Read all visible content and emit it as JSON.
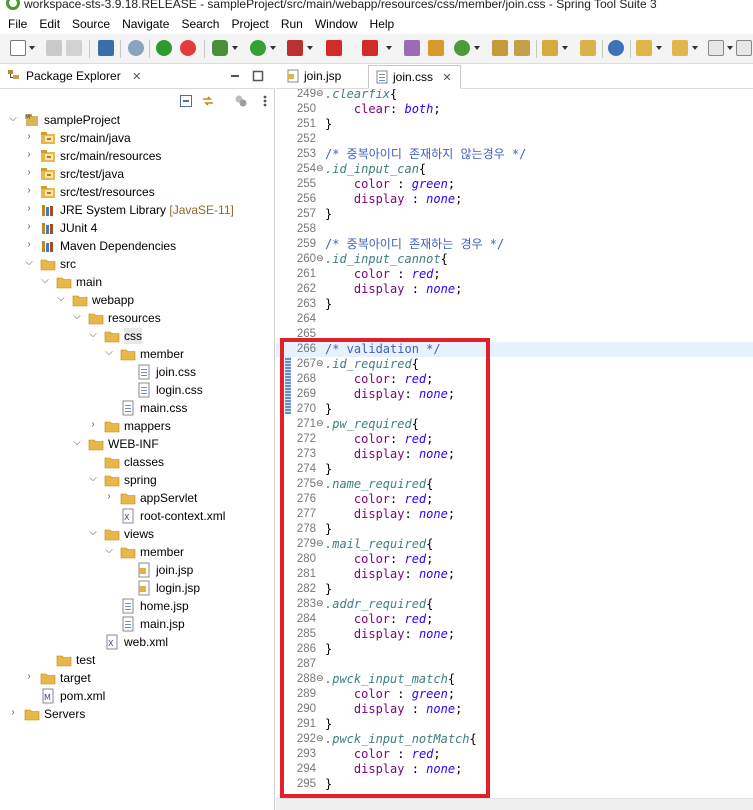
{
  "window": {
    "title": "workspace-sts-3.9.18.RELEASE - sampleProject/src/main/webapp/resources/css/member/join.css - Spring Tool Suite 3"
  },
  "menu": [
    "File",
    "Edit",
    "Source",
    "Navigate",
    "Search",
    "Project",
    "Run",
    "Window",
    "Help"
  ],
  "package_explorer": {
    "title": "Package Explorer",
    "close_glyph": "✕",
    "tree": [
      {
        "label": "sampleProject",
        "indent": 0,
        "twisty": "open",
        "icon": "project-icon"
      },
      {
        "label": "src/main/java",
        "indent": 1,
        "twisty": "closed",
        "icon": "source-folder-icon"
      },
      {
        "label": "src/main/resources",
        "indent": 1,
        "twisty": "closed",
        "icon": "source-folder-icon"
      },
      {
        "label": "src/test/java",
        "indent": 1,
        "twisty": "closed",
        "icon": "source-folder-icon"
      },
      {
        "label": "src/test/resources",
        "indent": 1,
        "twisty": "closed",
        "icon": "source-folder-icon"
      },
      {
        "label": "JRE System Library",
        "decoration": " [JavaSE-11]",
        "indent": 1,
        "twisty": "closed",
        "icon": "library-icon"
      },
      {
        "label": "JUnit 4",
        "indent": 1,
        "twisty": "closed",
        "icon": "library-icon"
      },
      {
        "label": "Maven Dependencies",
        "indent": 1,
        "twisty": "closed",
        "icon": "library-icon"
      },
      {
        "label": "src",
        "indent": 1,
        "twisty": "open",
        "icon": "folder-icon"
      },
      {
        "label": "main",
        "indent": 2,
        "twisty": "open",
        "icon": "folder-icon"
      },
      {
        "label": "webapp",
        "indent": 3,
        "twisty": "open",
        "icon": "folder-icon"
      },
      {
        "label": "resources",
        "indent": 4,
        "twisty": "open",
        "icon": "folder-icon"
      },
      {
        "label": "css",
        "indent": 5,
        "twisty": "open",
        "icon": "folder-icon",
        "selected": true
      },
      {
        "label": "member",
        "indent": 6,
        "twisty": "open",
        "icon": "folder-icon"
      },
      {
        "label": "join.css",
        "indent": 7,
        "twisty": "none",
        "icon": "file-icon"
      },
      {
        "label": "login.css",
        "indent": 7,
        "twisty": "none",
        "icon": "file-icon"
      },
      {
        "label": "main.css",
        "indent": 6,
        "twisty": "none",
        "icon": "file-icon"
      },
      {
        "label": "mappers",
        "indent": 5,
        "twisty": "closed",
        "icon": "folder-icon"
      },
      {
        "label": "WEB-INF",
        "indent": 4,
        "twisty": "open",
        "icon": "folder-icon"
      },
      {
        "label": "classes",
        "indent": 5,
        "twisty": "none",
        "icon": "folder-icon"
      },
      {
        "label": "spring",
        "indent": 5,
        "twisty": "open",
        "icon": "folder-icon"
      },
      {
        "label": "appServlet",
        "indent": 6,
        "twisty": "closed",
        "icon": "folder-icon"
      },
      {
        "label": "root-context.xml",
        "indent": 6,
        "twisty": "none",
        "icon": "xml-file-icon"
      },
      {
        "label": "views",
        "indent": 5,
        "twisty": "open",
        "icon": "folder-icon"
      },
      {
        "label": "member",
        "indent": 6,
        "twisty": "open",
        "icon": "folder-icon"
      },
      {
        "label": "join.jsp",
        "indent": 7,
        "twisty": "none",
        "icon": "jsp-file-icon"
      },
      {
        "label": "login.jsp",
        "indent": 7,
        "twisty": "none",
        "icon": "jsp-file-icon"
      },
      {
        "label": "home.jsp",
        "indent": 6,
        "twisty": "none",
        "icon": "file-icon"
      },
      {
        "label": "main.jsp",
        "indent": 6,
        "twisty": "none",
        "icon": "file-icon"
      },
      {
        "label": "web.xml",
        "indent": 5,
        "twisty": "none",
        "icon": "xml-file-icon"
      },
      {
        "label": "test",
        "indent": 2,
        "twisty": "none",
        "icon": "folder-icon"
      },
      {
        "label": "target",
        "indent": 1,
        "twisty": "closed",
        "icon": "folder-icon"
      },
      {
        "label": "pom.xml",
        "indent": 1,
        "twisty": "none",
        "icon": "maven-file-icon"
      },
      {
        "label": "Servers",
        "indent": 0,
        "twisty": "closed",
        "icon": "folder-icon"
      }
    ]
  },
  "editor": {
    "tabs": [
      {
        "label": "join.jsp",
        "active": false
      },
      {
        "label": "join.css",
        "active": true
      }
    ],
    "close_glyph": "✕",
    "lines": [
      {
        "n": "249",
        "fold": "⊖",
        "tokens": [
          {
            "t": "sel",
            "v": ".clearfix"
          },
          {
            "t": "pun",
            "v": "{"
          }
        ]
      },
      {
        "n": "250",
        "tokens": [
          {
            "t": "pun",
            "v": "    "
          },
          {
            "t": "prop",
            "v": "clear"
          },
          {
            "t": "pun",
            "v": ": "
          },
          {
            "t": "val",
            "v": "both"
          },
          {
            "t": "pun",
            "v": ";"
          }
        ]
      },
      {
        "n": "251",
        "tokens": [
          {
            "t": "pun",
            "v": "}"
          }
        ]
      },
      {
        "n": "252",
        "tokens": []
      },
      {
        "n": "253",
        "tokens": [
          {
            "t": "cmt",
            "v": "/* 중복아이디 존재하지 않는경우 */"
          }
        ]
      },
      {
        "n": "254",
        "fold": "⊖",
        "tokens": [
          {
            "t": "sel",
            "v": ".id_input_can"
          },
          {
            "t": "pun",
            "v": "{"
          }
        ]
      },
      {
        "n": "255",
        "tokens": [
          {
            "t": "pun",
            "v": "    "
          },
          {
            "t": "prop",
            "v": "color"
          },
          {
            "t": "pun",
            "v": " : "
          },
          {
            "t": "val",
            "v": "green"
          },
          {
            "t": "pun",
            "v": ";"
          }
        ]
      },
      {
        "n": "256",
        "tokens": [
          {
            "t": "pun",
            "v": "    "
          },
          {
            "t": "prop",
            "v": "display"
          },
          {
            "t": "pun",
            "v": " : "
          },
          {
            "t": "val",
            "v": "none"
          },
          {
            "t": "pun",
            "v": ";"
          }
        ]
      },
      {
        "n": "257",
        "tokens": [
          {
            "t": "pun",
            "v": "}"
          }
        ]
      },
      {
        "n": "258",
        "tokens": []
      },
      {
        "n": "259",
        "tokens": [
          {
            "t": "cmt",
            "v": "/* 중복아이디 존재하는 경우 */"
          }
        ]
      },
      {
        "n": "260",
        "fold": "⊖",
        "tokens": [
          {
            "t": "sel",
            "v": ".id_input_cannot"
          },
          {
            "t": "pun",
            "v": "{"
          }
        ]
      },
      {
        "n": "261",
        "tokens": [
          {
            "t": "pun",
            "v": "    "
          },
          {
            "t": "prop",
            "v": "color"
          },
          {
            "t": "pun",
            "v": " : "
          },
          {
            "t": "val",
            "v": "red"
          },
          {
            "t": "pun",
            "v": ";"
          }
        ]
      },
      {
        "n": "262",
        "tokens": [
          {
            "t": "pun",
            "v": "    "
          },
          {
            "t": "prop",
            "v": "display"
          },
          {
            "t": "pun",
            "v": " : "
          },
          {
            "t": "val",
            "v": "none"
          },
          {
            "t": "pun",
            "v": ";"
          }
        ]
      },
      {
        "n": "263",
        "tokens": [
          {
            "t": "pun",
            "v": "}"
          }
        ]
      },
      {
        "n": "264",
        "tokens": []
      },
      {
        "n": "265",
        "tokens": []
      },
      {
        "n": "266",
        "highlight": true,
        "tokens": [
          {
            "t": "cmt",
            "v": "/* validation */"
          }
        ]
      },
      {
        "n": "267",
        "fold": "⊖",
        "tokens": [
          {
            "t": "sel",
            "v": ".id_required"
          },
          {
            "t": "pun",
            "v": "{"
          }
        ]
      },
      {
        "n": "268",
        "tokens": [
          {
            "t": "pun",
            "v": "    "
          },
          {
            "t": "prop",
            "v": "color"
          },
          {
            "t": "pun",
            "v": ": "
          },
          {
            "t": "val",
            "v": "red"
          },
          {
            "t": "pun",
            "v": ";"
          }
        ]
      },
      {
        "n": "269",
        "tokens": [
          {
            "t": "pun",
            "v": "    "
          },
          {
            "t": "prop",
            "v": "display"
          },
          {
            "t": "pun",
            "v": ": "
          },
          {
            "t": "val",
            "v": "none"
          },
          {
            "t": "pun",
            "v": ";"
          }
        ]
      },
      {
        "n": "270",
        "tokens": [
          {
            "t": "pun",
            "v": "}"
          }
        ]
      },
      {
        "n": "271",
        "fold": "⊖",
        "tokens": [
          {
            "t": "sel",
            "v": ".pw_required"
          },
          {
            "t": "pun",
            "v": "{"
          }
        ]
      },
      {
        "n": "272",
        "tokens": [
          {
            "t": "pun",
            "v": "    "
          },
          {
            "t": "prop",
            "v": "color"
          },
          {
            "t": "pun",
            "v": ": "
          },
          {
            "t": "val",
            "v": "red"
          },
          {
            "t": "pun",
            "v": ";"
          }
        ]
      },
      {
        "n": "273",
        "tokens": [
          {
            "t": "pun",
            "v": "    "
          },
          {
            "t": "prop",
            "v": "display"
          },
          {
            "t": "pun",
            "v": ": "
          },
          {
            "t": "val",
            "v": "none"
          },
          {
            "t": "pun",
            "v": ";"
          }
        ]
      },
      {
        "n": "274",
        "tokens": [
          {
            "t": "pun",
            "v": "}"
          }
        ]
      },
      {
        "n": "275",
        "fold": "⊖",
        "tokens": [
          {
            "t": "sel",
            "v": ".name_required"
          },
          {
            "t": "pun",
            "v": "{"
          }
        ]
      },
      {
        "n": "276",
        "tokens": [
          {
            "t": "pun",
            "v": "    "
          },
          {
            "t": "prop",
            "v": "color"
          },
          {
            "t": "pun",
            "v": ": "
          },
          {
            "t": "val",
            "v": "red"
          },
          {
            "t": "pun",
            "v": ";"
          }
        ]
      },
      {
        "n": "277",
        "tokens": [
          {
            "t": "pun",
            "v": "    "
          },
          {
            "t": "prop",
            "v": "display"
          },
          {
            "t": "pun",
            "v": ": "
          },
          {
            "t": "val",
            "v": "none"
          },
          {
            "t": "pun",
            "v": ";"
          }
        ]
      },
      {
        "n": "278",
        "tokens": [
          {
            "t": "pun",
            "v": "}"
          }
        ]
      },
      {
        "n": "279",
        "fold": "⊖",
        "tokens": [
          {
            "t": "sel",
            "v": ".mail_required"
          },
          {
            "t": "pun",
            "v": "{"
          }
        ]
      },
      {
        "n": "280",
        "tokens": [
          {
            "t": "pun",
            "v": "    "
          },
          {
            "t": "prop",
            "v": "color"
          },
          {
            "t": "pun",
            "v": ": "
          },
          {
            "t": "val",
            "v": "red"
          },
          {
            "t": "pun",
            "v": ";"
          }
        ]
      },
      {
        "n": "281",
        "tokens": [
          {
            "t": "pun",
            "v": "    "
          },
          {
            "t": "prop",
            "v": "display"
          },
          {
            "t": "pun",
            "v": ": "
          },
          {
            "t": "val",
            "v": "none"
          },
          {
            "t": "pun",
            "v": ";"
          }
        ]
      },
      {
        "n": "282",
        "tokens": [
          {
            "t": "pun",
            "v": "}"
          }
        ]
      },
      {
        "n": "283",
        "fold": "⊖",
        "tokens": [
          {
            "t": "sel",
            "v": ".addr_required"
          },
          {
            "t": "pun",
            "v": "{"
          }
        ]
      },
      {
        "n": "284",
        "tokens": [
          {
            "t": "pun",
            "v": "    "
          },
          {
            "t": "prop",
            "v": "color"
          },
          {
            "t": "pun",
            "v": ": "
          },
          {
            "t": "val",
            "v": "red"
          },
          {
            "t": "pun",
            "v": ";"
          }
        ]
      },
      {
        "n": "285",
        "tokens": [
          {
            "t": "pun",
            "v": "    "
          },
          {
            "t": "prop",
            "v": "display"
          },
          {
            "t": "pun",
            "v": ": "
          },
          {
            "t": "val",
            "v": "none"
          },
          {
            "t": "pun",
            "v": ";"
          }
        ]
      },
      {
        "n": "286",
        "tokens": [
          {
            "t": "pun",
            "v": "}"
          }
        ]
      },
      {
        "n": "287",
        "tokens": []
      },
      {
        "n": "288",
        "fold": "⊖",
        "tokens": [
          {
            "t": "sel",
            "v": ".pwck_input_match"
          },
          {
            "t": "pun",
            "v": "{"
          }
        ]
      },
      {
        "n": "289",
        "tokens": [
          {
            "t": "pun",
            "v": "    "
          },
          {
            "t": "prop",
            "v": "color"
          },
          {
            "t": "pun",
            "v": " : "
          },
          {
            "t": "val",
            "v": "green"
          },
          {
            "t": "pun",
            "v": ";"
          }
        ]
      },
      {
        "n": "290",
        "tokens": [
          {
            "t": "pun",
            "v": "    "
          },
          {
            "t": "prop",
            "v": "display"
          },
          {
            "t": "pun",
            "v": " : "
          },
          {
            "t": "val",
            "v": "none"
          },
          {
            "t": "pun",
            "v": ";"
          }
        ]
      },
      {
        "n": "291",
        "tokens": [
          {
            "t": "pun",
            "v": "}"
          }
        ]
      },
      {
        "n": "292",
        "fold": "⊖",
        "tokens": [
          {
            "t": "sel",
            "v": ".pwck_input_notMatch"
          },
          {
            "t": "pun",
            "v": "{"
          }
        ]
      },
      {
        "n": "293",
        "tokens": [
          {
            "t": "pun",
            "v": "    "
          },
          {
            "t": "prop",
            "v": "color"
          },
          {
            "t": "pun",
            "v": " : "
          },
          {
            "t": "val",
            "v": "red"
          },
          {
            "t": "pun",
            "v": ";"
          }
        ]
      },
      {
        "n": "294",
        "tokens": [
          {
            "t": "pun",
            "v": "    "
          },
          {
            "t": "prop",
            "v": "display"
          },
          {
            "t": "pun",
            "v": " : "
          },
          {
            "t": "val",
            "v": "none"
          },
          {
            "t": "pun",
            "v": ";"
          }
        ]
      },
      {
        "n": "295",
        "tokens": [
          {
            "t": "pun",
            "v": "}"
          }
        ]
      }
    ]
  },
  "colors": {
    "annotation_box": "#e3202a",
    "current_line": "#e8f2fe",
    "comment": "#3f5fbf",
    "selector": "#3f7f7f",
    "property": "#7f007f",
    "value": "#2a00ff",
    "folder": "#e8b84a"
  }
}
